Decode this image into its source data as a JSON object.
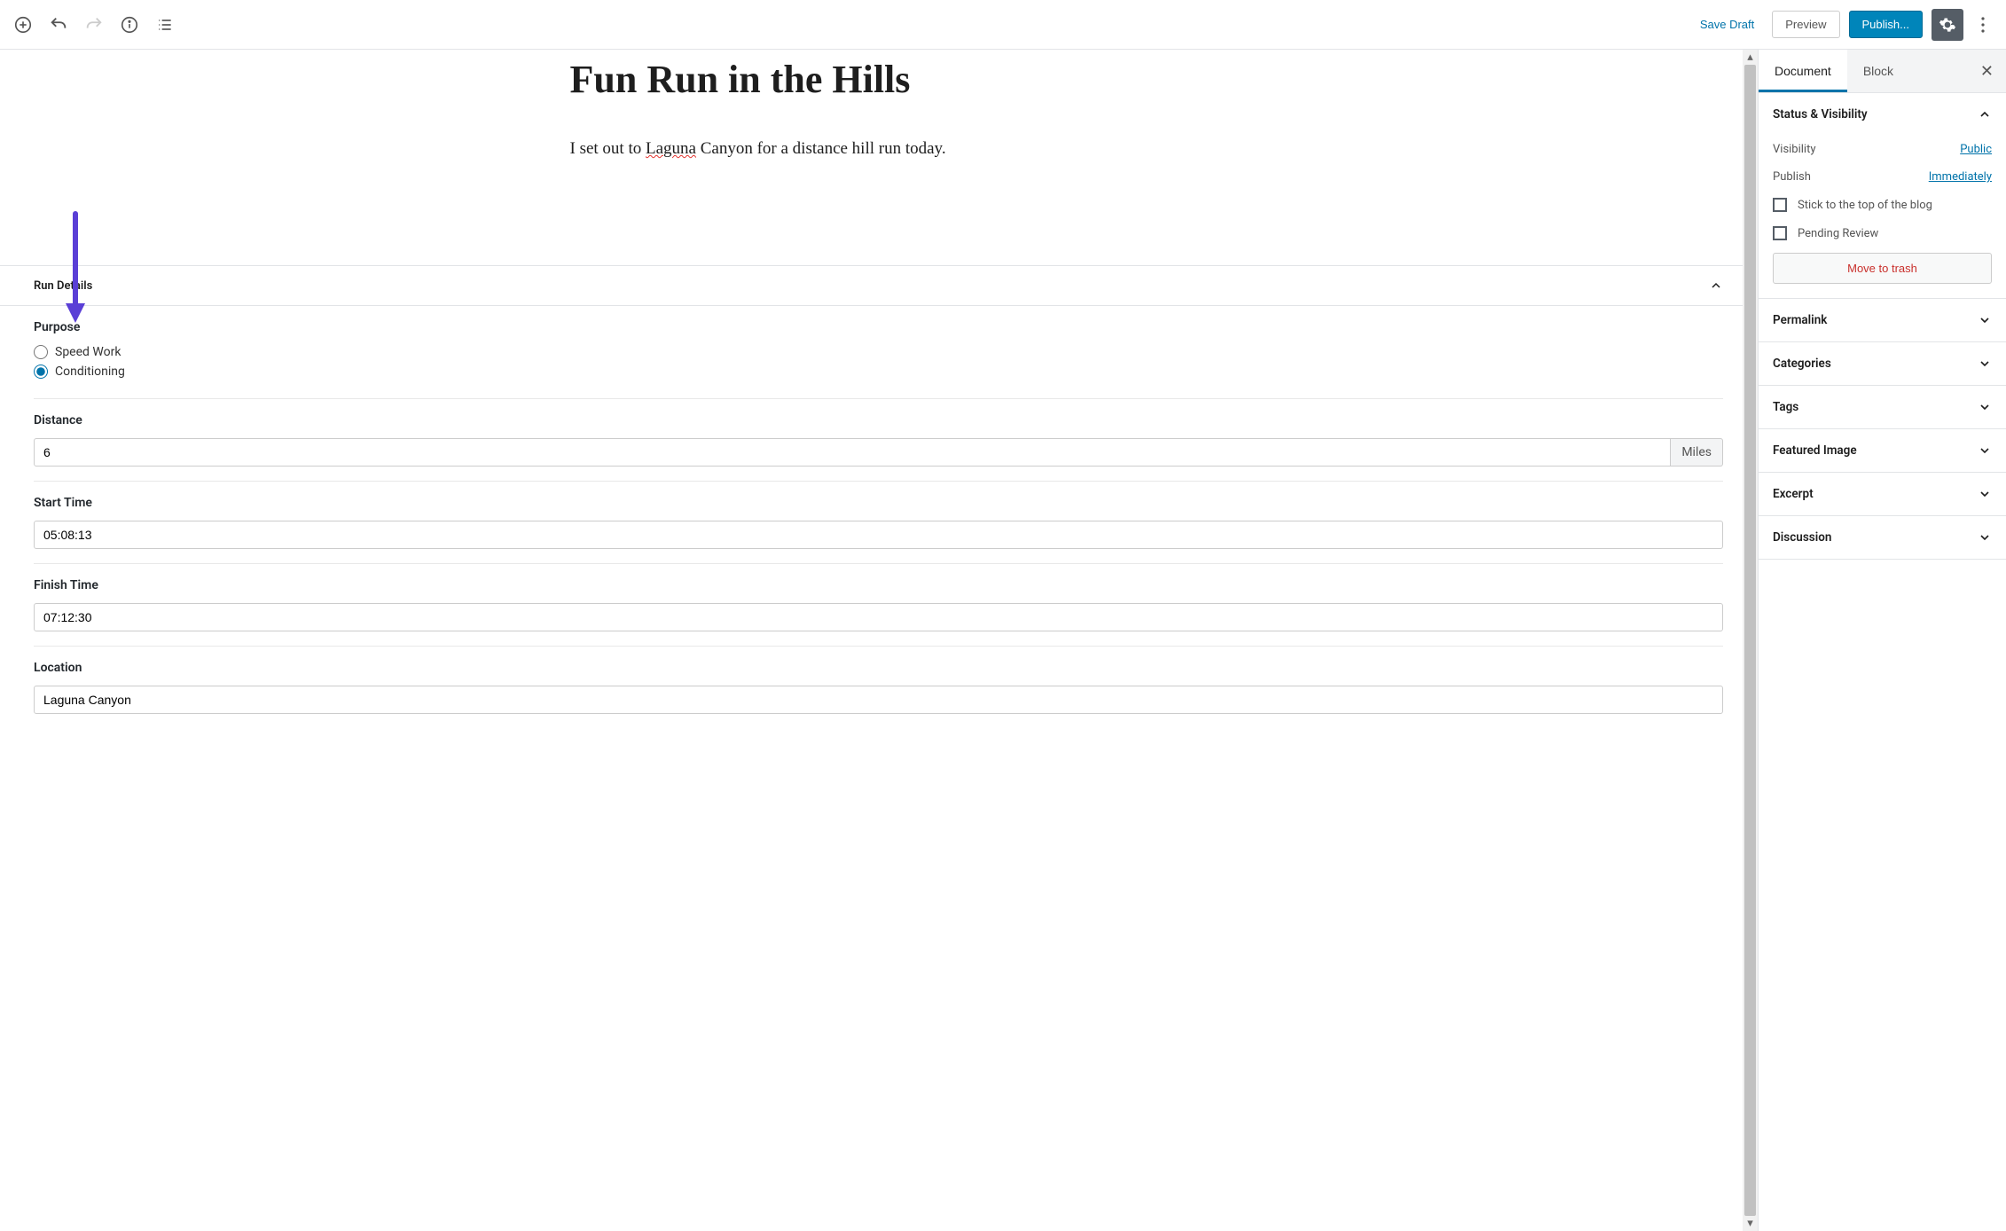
{
  "topbar": {
    "save_draft": "Save Draft",
    "preview": "Preview",
    "publish": "Publish..."
  },
  "post": {
    "title": "Fun Run in the Hills",
    "body_pre": "I set out to ",
    "body_squiggle": "Laguna",
    "body_post": " Canyon for a distance hill run today."
  },
  "meta": {
    "section_title": "Run Details",
    "purpose_label": "Purpose",
    "purpose_options": {
      "speed": "Speed Work",
      "cond": "Conditioning"
    },
    "purpose_selected": "cond",
    "distance_label": "Distance",
    "distance_value": "6",
    "distance_unit": "Miles",
    "start_label": "Start Time",
    "start_value": "05:08:13",
    "finish_label": "Finish Time",
    "finish_value": "07:12:30",
    "location_label": "Location",
    "location_value": "Laguna Canyon"
  },
  "sidebar": {
    "tabs": {
      "document": "Document",
      "block": "Block"
    },
    "status": {
      "title": "Status & Visibility",
      "visibility_label": "Visibility",
      "visibility_value": "Public",
      "publish_label": "Publish",
      "publish_value": "Immediately",
      "stick": "Stick to the top of the blog",
      "pending": "Pending Review",
      "trash": "Move to trash"
    },
    "panels": {
      "permalink": "Permalink",
      "categories": "Categories",
      "tags": "Tags",
      "featured": "Featured Image",
      "excerpt": "Excerpt",
      "discussion": "Discussion"
    }
  }
}
